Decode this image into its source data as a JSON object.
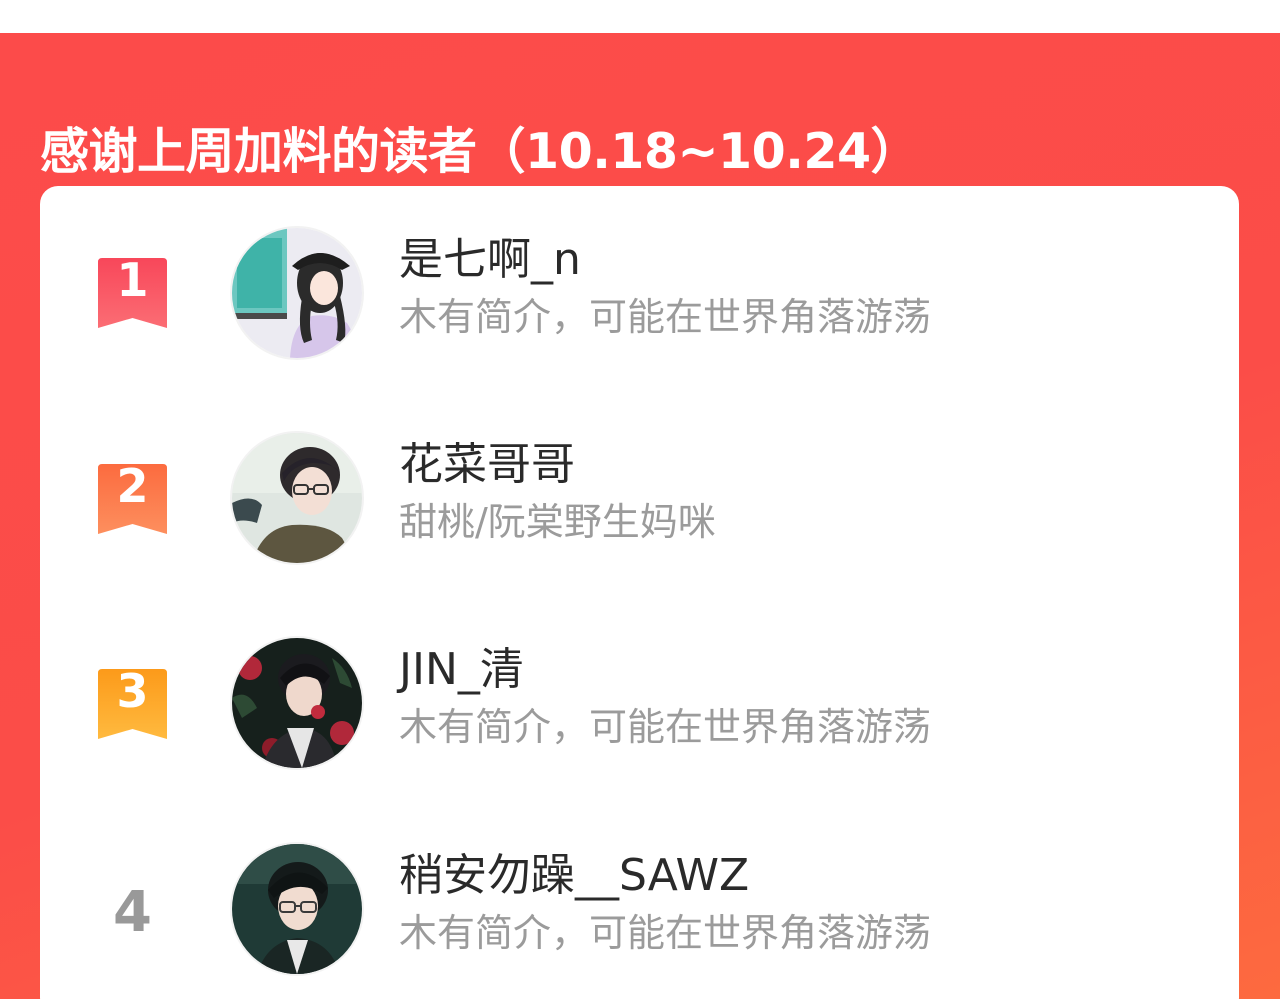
{
  "header": {
    "title": "感谢上周加料的读者（10.18~10.24）"
  },
  "colors": {
    "banner": "#fc4b4a",
    "rank1": "#f9565f",
    "rank2": "#fd7a48",
    "rank3": "#fd9d2a",
    "rank_plain": "#999999"
  },
  "readers": [
    {
      "rank": "1",
      "name": "是七啊_n",
      "bio": "木有简介，可能在世界角落游荡",
      "avatar_icon": "girl-cap-avatar"
    },
    {
      "rank": "2",
      "name": "花菜哥哥",
      "bio": "甜桃/阮棠野生妈咪",
      "avatar_icon": "boy-glasses-avatar"
    },
    {
      "rank": "3",
      "name": "JIN_清",
      "bio": "木有简介，可能在世界角落游荡",
      "avatar_icon": "man-roses-avatar"
    },
    {
      "rank": "4",
      "name": "稍安勿躁__SAWZ",
      "bio": "木有简介，可能在世界角落游荡",
      "avatar_icon": "man-glasses-dark-avatar"
    }
  ]
}
